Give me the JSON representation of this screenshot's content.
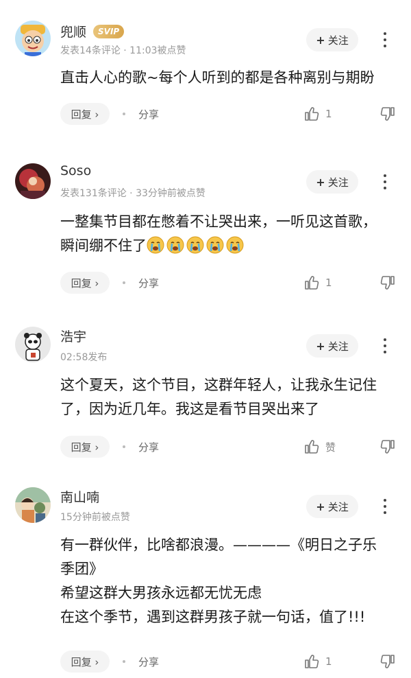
{
  "common": {
    "follow_label": "+ 关注",
    "follow_text": "关注",
    "reply_label": "回复 ›",
    "share_label": "分享"
  },
  "comments": [
    {
      "username": "兜顺",
      "badge": "SVIP",
      "meta": "发表14条评论 · 11:03被点赞",
      "text": "直击人心的歌~每个人听到的都是各种离别与期盼",
      "likes": "1"
    },
    {
      "username": "Soso",
      "meta": "发表131条评论 · 33分钟前被点赞",
      "text": "一整集节目都在憋着不让哭出来，一听见这首歌，\n瞬间绷不住了",
      "emoji_count": 5,
      "likes": "1"
    },
    {
      "username": "浩宇",
      "meta": "02:58发布",
      "text": "这个夏天，这个节目，这群年轻人，让我永生记住\n了，因为近几年。我这是看节目哭出来了",
      "likes": "赞"
    },
    {
      "username": "南山喃",
      "meta": "15分钟前被点赞",
      "text": "有一群伙伴，比啥都浪漫。————《明日之子乐\n季团》\n希望这群大男孩永远都无忧无虑\n在这个季节，遇到这群男孩子就一句话，值了!!!",
      "likes": "1"
    }
  ],
  "colors": {
    "text": "#1a1a1a",
    "meta": "#999999",
    "button_bg": "#f4f4f4",
    "svip_gold": "#d9a64c"
  },
  "icons": [
    "avatar",
    "plus-icon",
    "more-vertical-icon",
    "chevron-right-icon",
    "thumbs-up-icon",
    "thumbs-down-icon",
    "crying-emoji-icon"
  ]
}
